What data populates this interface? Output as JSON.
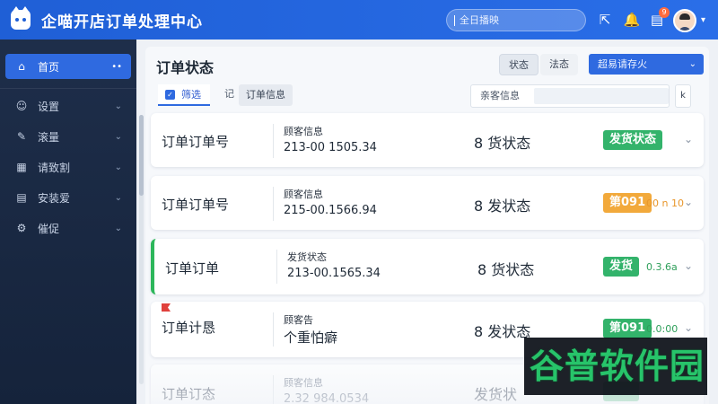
{
  "app": {
    "title": "企喵开店订单处理中心"
  },
  "topbar": {
    "search_placeholder": "全日播映",
    "notification_count": "9"
  },
  "sidebar": {
    "items": [
      {
        "label": "首页",
        "icon": "home-icon",
        "active": true
      },
      {
        "label": "设置",
        "icon": "user-icon"
      },
      {
        "label": "滚量",
        "icon": "edit-icon"
      },
      {
        "label": "请致割",
        "icon": "calendar-icon"
      },
      {
        "label": "安装爱",
        "icon": "document-icon"
      },
      {
        "label": "催促",
        "icon": "settings-icon"
      }
    ]
  },
  "main": {
    "page_title": "订单状态",
    "segments": [
      "状态",
      "法态"
    ],
    "select_value": "超易请存火",
    "filter": {
      "active_chip": "筛选",
      "label": "记",
      "order_chip": "订单信息",
      "search_label": "亲客信息",
      "sort_label": "k"
    }
  },
  "orders": [
    {
      "title": "订单订单号",
      "label": "顾客信息",
      "value": "213-00 1505.34",
      "status": "8 货状态",
      "tag": "发货状态",
      "tag_color": "#33b36b",
      "aux": ""
    },
    {
      "title": "订单订单号",
      "label": "顾客信息",
      "value": "215-00.1566.94",
      "status": "8 发状态",
      "tag": "第091",
      "tag_color": "#f2a93b",
      "aux": "00 n 10"
    },
    {
      "title": "订单订单",
      "label": "发货状态",
      "value": "213-00.1565.34",
      "status": "8 货状态",
      "tag": "发货",
      "tag_color": "#33b36b",
      "aux": "0.3.6a"
    },
    {
      "title": "订单计恳",
      "label": "顾客告",
      "value": "个重怕癖",
      "status": "8 发状态",
      "tag": "第091",
      "tag_color": "#33b36b",
      "aux": "0.0:00"
    },
    {
      "title": "订单订态",
      "label": "顾客信息",
      "value": "2.32 984.0534",
      "status": "发货状",
      "tag": "",
      "tag_color": "#33b36b",
      "aux": ""
    }
  ],
  "watermark": {
    "text": "谷普软件园"
  }
}
